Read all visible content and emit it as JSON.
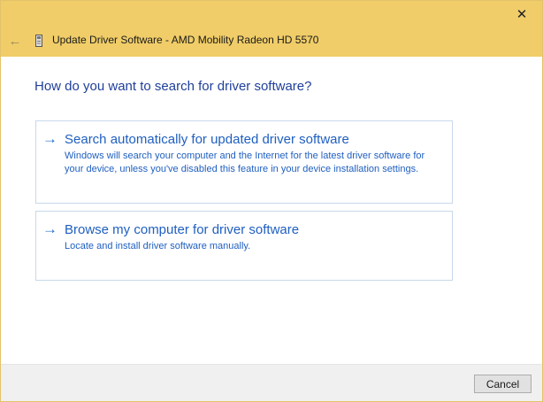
{
  "window": {
    "title": "Update Driver Software - AMD Mobility Radeon HD 5570",
    "close_glyph": "✕",
    "back_glyph": "←",
    "titlebar_color": "#f0cd68",
    "accent_color": "#1f5fc0"
  },
  "content": {
    "heading": "How do you want to search for driver software?",
    "options": [
      {
        "arrow": "→",
        "title": "Search automatically for updated driver software",
        "description": "Windows will search your computer and the Internet for the latest driver software for your device, unless you've disabled this feature in your device installation settings."
      },
      {
        "arrow": "→",
        "title": "Browse my computer for driver software",
        "description": "Locate and install driver software manually."
      }
    ]
  },
  "footer": {
    "cancel_label": "Cancel"
  },
  "icons": {
    "back": "back-arrow-icon",
    "device": "device-icon",
    "close": "close-icon",
    "option_arrow": "right-arrow-icon"
  }
}
